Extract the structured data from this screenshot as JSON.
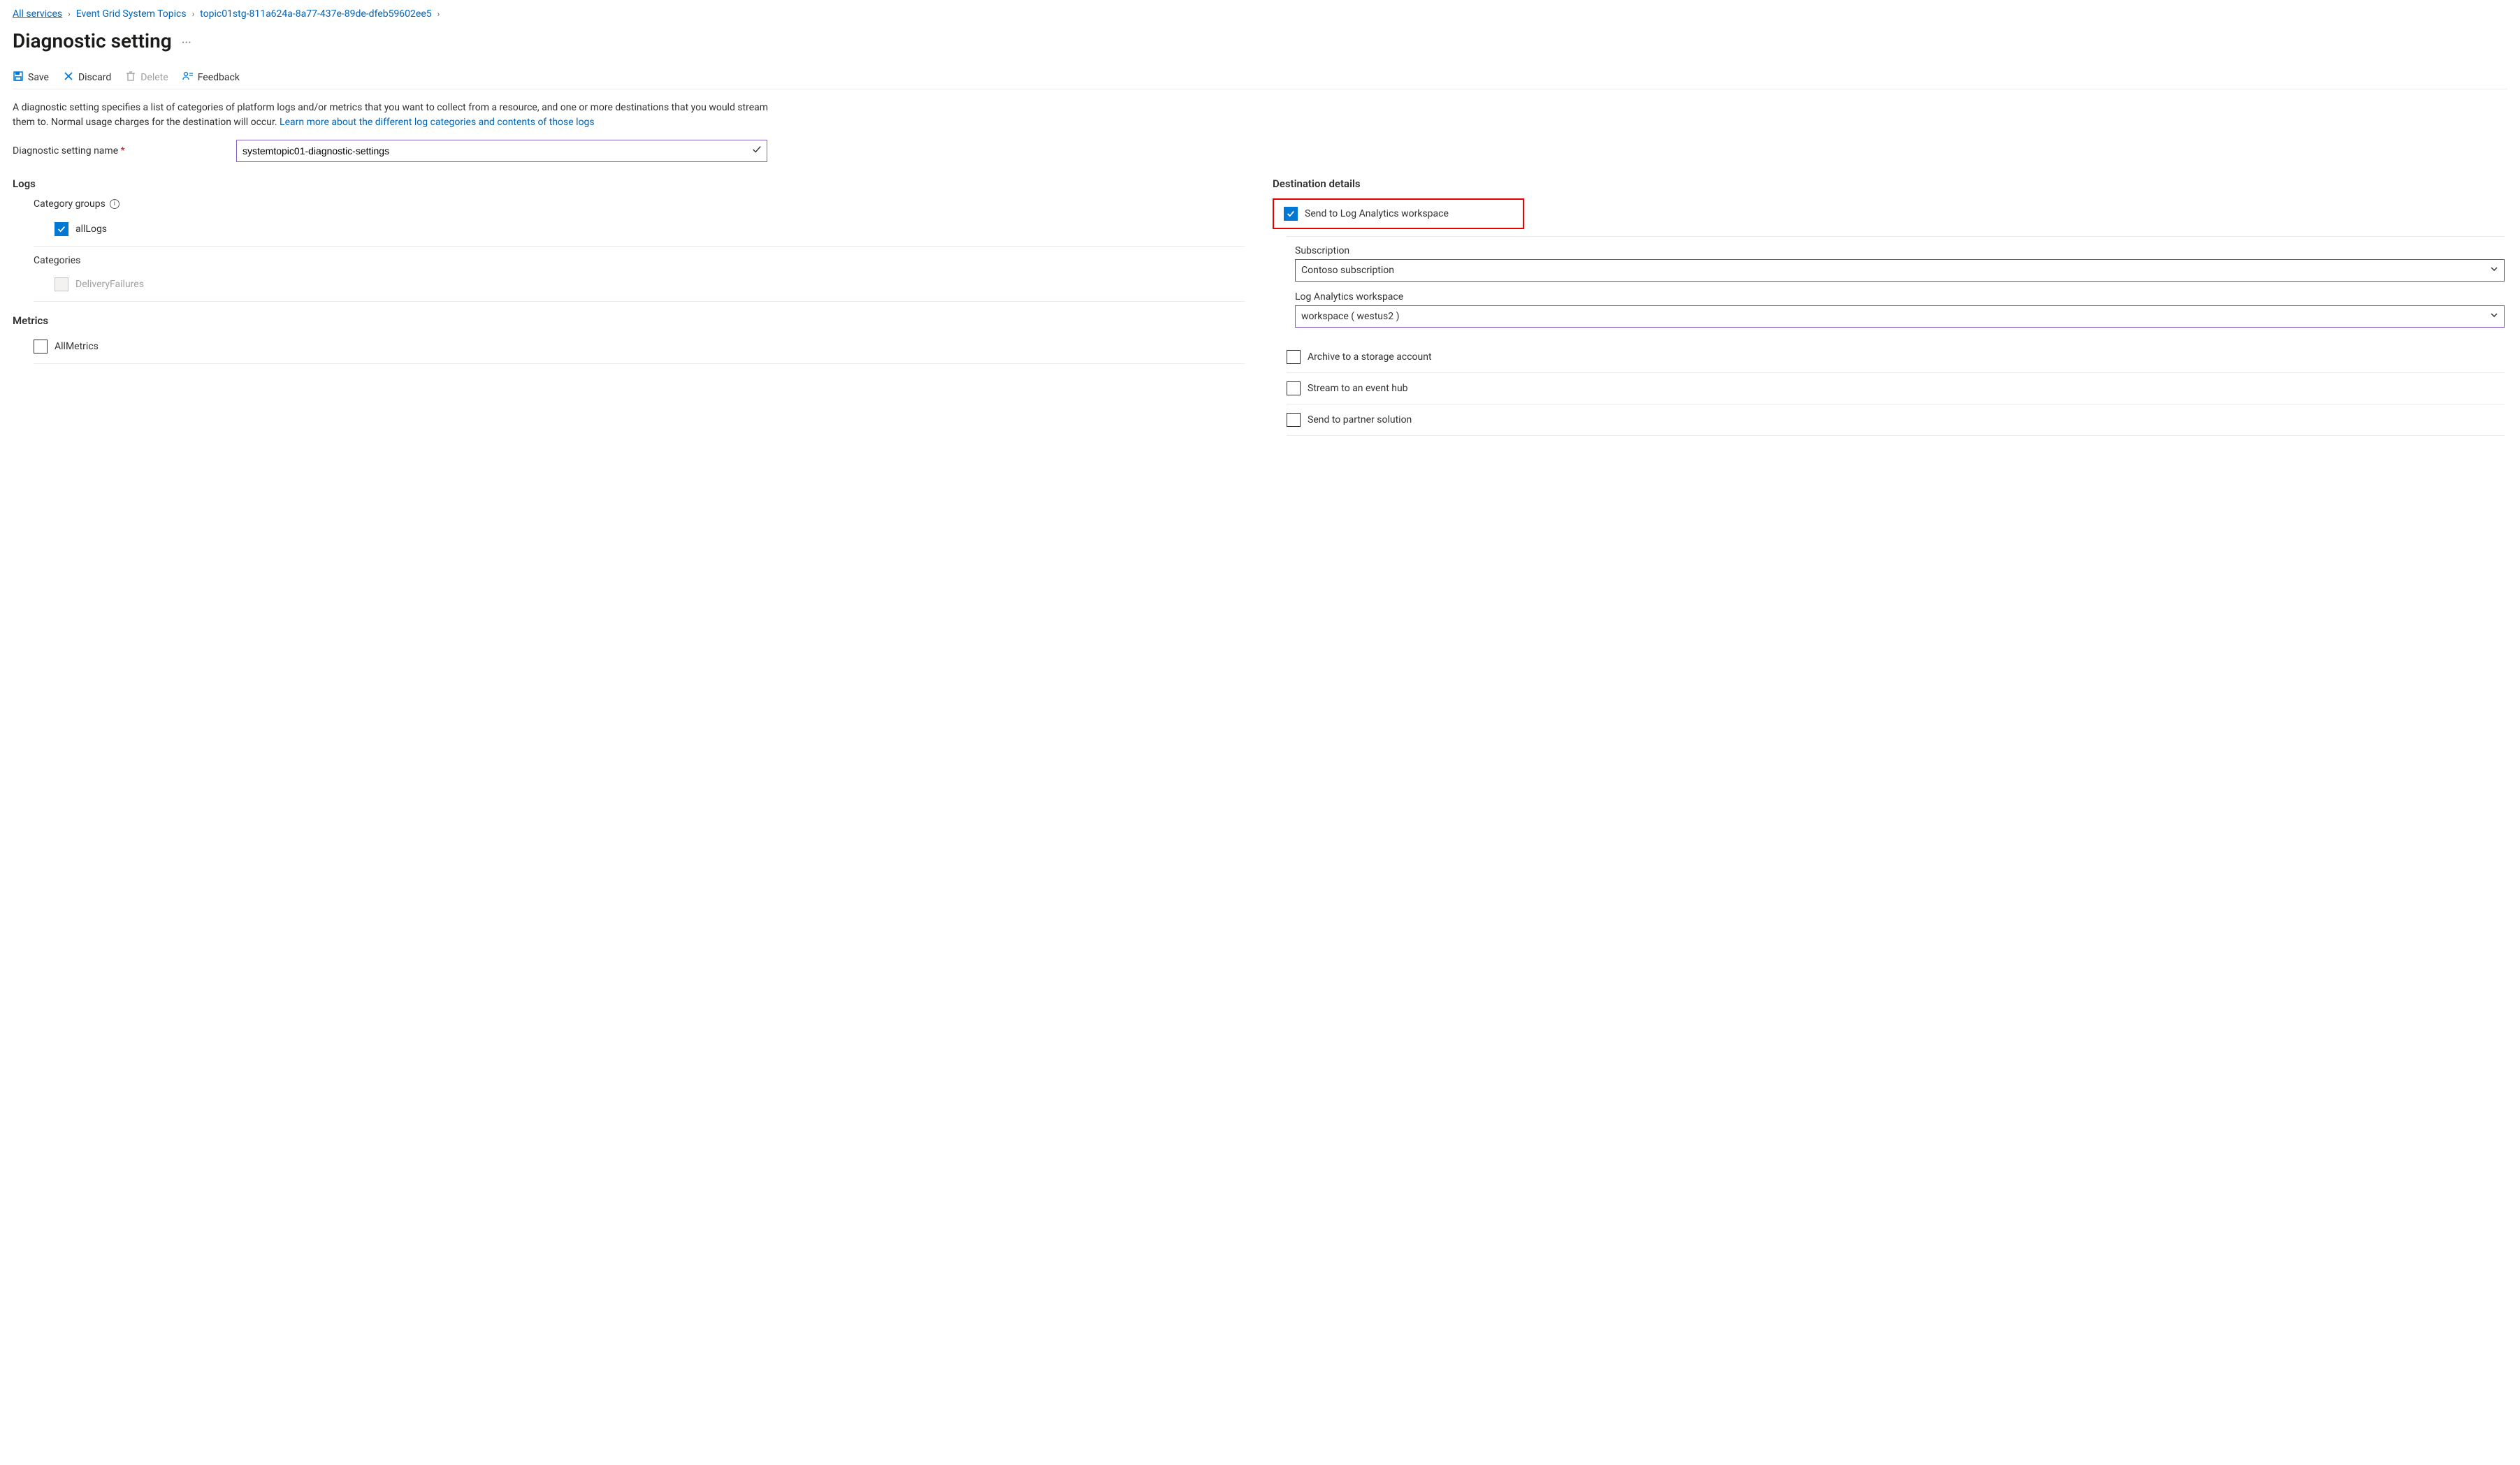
{
  "breadcrumb": {
    "items": [
      {
        "label": "All services"
      },
      {
        "label": "Event Grid System Topics"
      },
      {
        "label": "topic01stg-811a624a-8a77-437e-89de-dfeb59602ee5"
      }
    ]
  },
  "page_title": "Diagnostic setting",
  "toolbar": {
    "save": "Save",
    "discard": "Discard",
    "delete": "Delete",
    "feedback": "Feedback"
  },
  "description": {
    "text_a": "A diagnostic setting specifies a list of categories of platform logs and/or metrics that you want to collect from a resource, and one or more destinations that you would stream them to. Normal usage charges for the destination will occur. ",
    "link": "Learn more about the different log categories and contents of those logs"
  },
  "name_field": {
    "label": "Diagnostic setting name",
    "value": "systemtopic01-diagnostic-settings"
  },
  "logs": {
    "heading": "Logs",
    "category_groups_label": "Category groups",
    "all_logs": {
      "label": "allLogs",
      "checked": true
    },
    "categories_label": "Categories",
    "delivery_failures": {
      "label": "DeliveryFailures",
      "checked": false,
      "disabled": true
    }
  },
  "metrics": {
    "heading": "Metrics",
    "all_metrics": {
      "label": "AllMetrics",
      "checked": false
    }
  },
  "dest": {
    "heading": "Destination details",
    "send_law": {
      "label": "Send to Log Analytics workspace",
      "checked": true
    },
    "subscription_label": "Subscription",
    "subscription_value": "Contoso subscription",
    "law_label": "Log Analytics workspace",
    "law_value": "workspace ( westus2 )",
    "archive_storage": {
      "label": "Archive to a storage account",
      "checked": false
    },
    "stream_eh": {
      "label": "Stream to an event hub",
      "checked": false
    },
    "send_partner": {
      "label": "Send to partner solution",
      "checked": false
    }
  }
}
